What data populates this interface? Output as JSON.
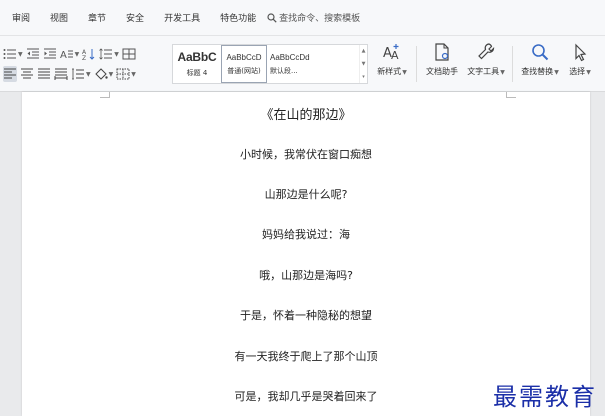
{
  "menu": {
    "items": [
      "审阅",
      "视图",
      "章节",
      "安全",
      "开发工具",
      "特色功能"
    ],
    "search_label": "查找命令、搜索模板"
  },
  "toolbar": {
    "styles": [
      {
        "sample": "AaBbC",
        "caption": "标题 4"
      },
      {
        "sample": "AaBbCcD",
        "caption": "普通(网站)"
      },
      {
        "sample": "AaBbCcDd",
        "caption": "默认段..."
      }
    ],
    "new_style_label": "新样式",
    "doc_helper_label": "文档助手",
    "text_tools_label": "文字工具",
    "find_replace_label": "查找替换",
    "select_label": "选择"
  },
  "document": {
    "title": "《在山的那边》",
    "lines": [
      "小时候，我常伏在窗口痴想",
      "山那边是什么呢?",
      "妈妈给我说过：海",
      "哦，山那边是海吗?",
      "于是，怀着一种隐秘的想望",
      "有一天我终于爬上了那个山顶",
      "可是，我却几乎是哭着回来了"
    ]
  },
  "watermark": "最需教育"
}
